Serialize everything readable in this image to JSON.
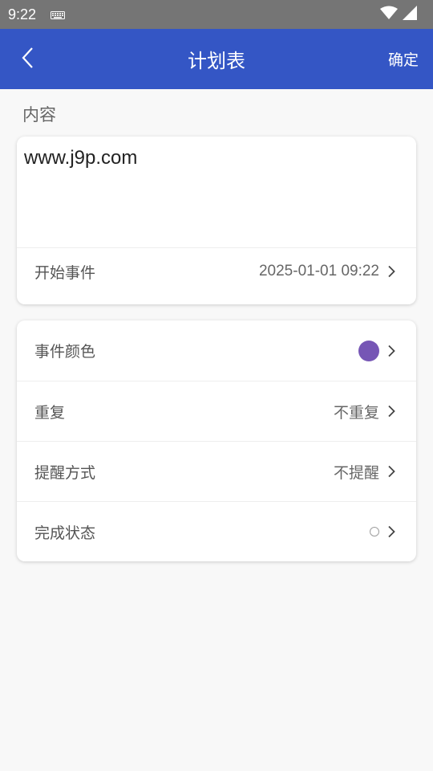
{
  "status_bar": {
    "time": "9:22"
  },
  "app_bar": {
    "title": "计划表",
    "confirm_label": "确定"
  },
  "content_section": {
    "label": "内容",
    "text": "www.j9p.com",
    "start_row": {
      "label": "开始事件",
      "value": "2025-01-01 09:22"
    }
  },
  "settings": {
    "color_row": {
      "label": "事件颜色",
      "color": "#7656b5"
    },
    "repeat_row": {
      "label": "重复",
      "value": "不重复"
    },
    "remind_row": {
      "label": "提醒方式",
      "value": "不提醒"
    },
    "complete_row": {
      "label": "完成状态"
    }
  },
  "colors": {
    "app_bar": "#3456c5",
    "status_bar": "#757575"
  },
  "icons": [
    "keyboard-icon",
    "wifi-icon",
    "signal-icon",
    "back-arrow-icon",
    "chevron-right-icon"
  ]
}
